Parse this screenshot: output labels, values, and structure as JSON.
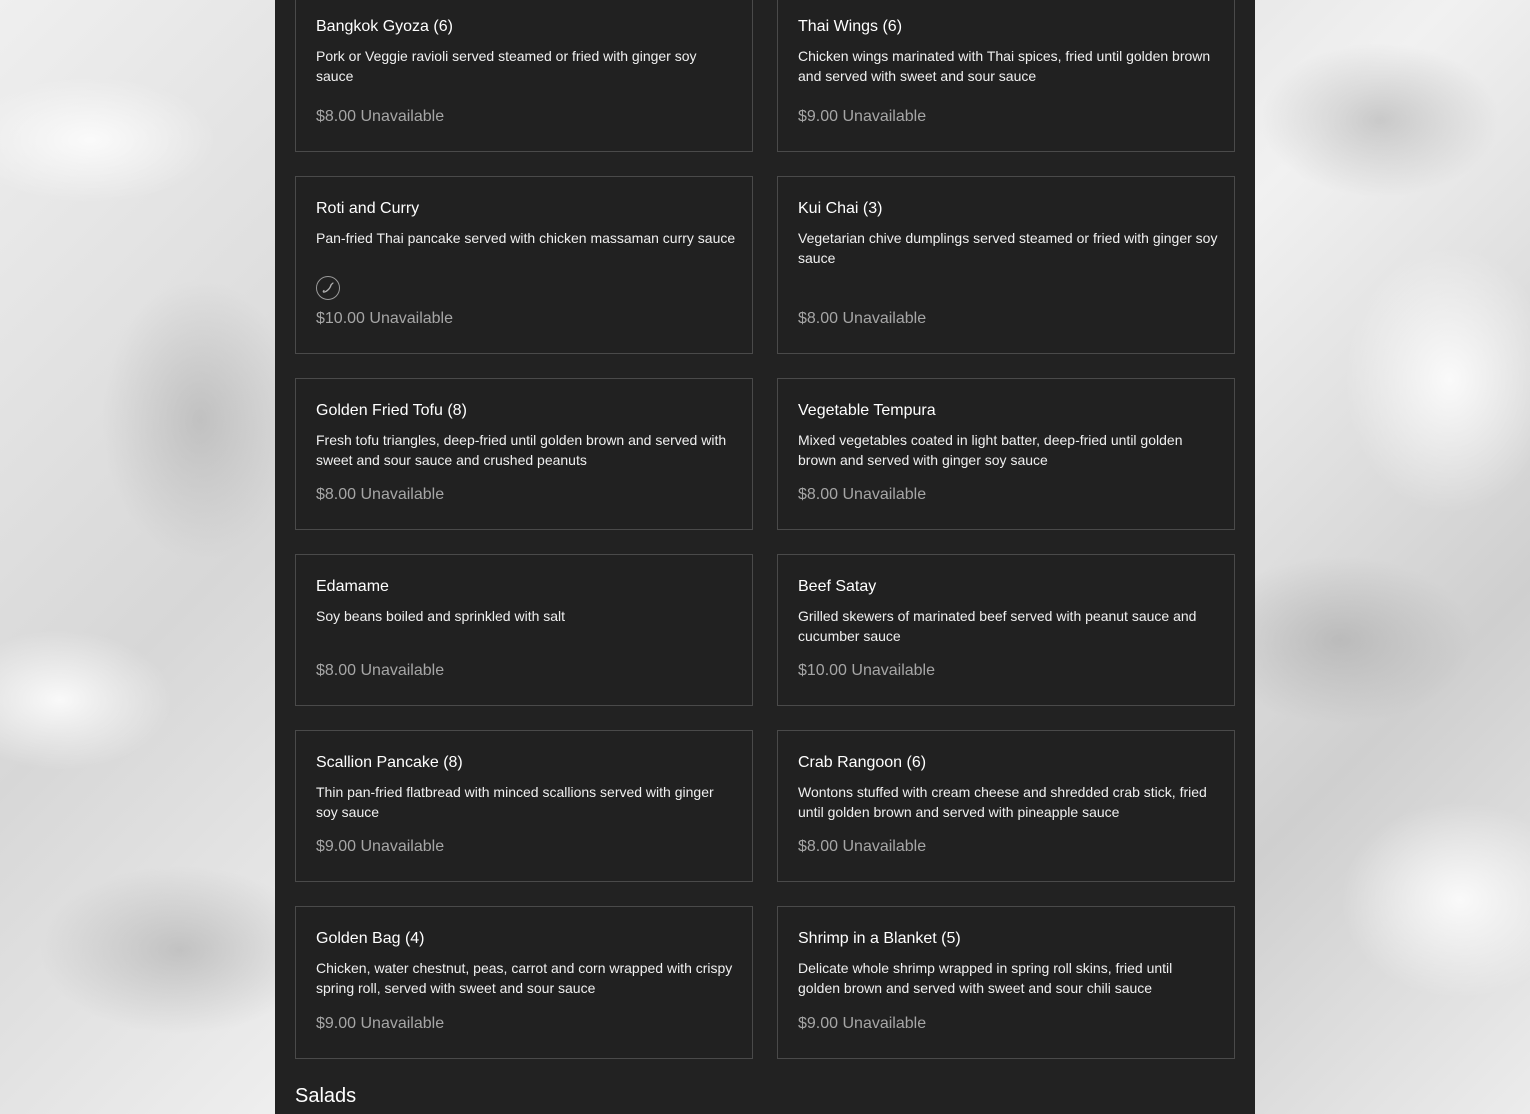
{
  "menu": {
    "items": [
      {
        "name": "Bangkok Gyoza (6)",
        "description": "Pork or Veggie ravioli served steamed or fried with ginger soy sauce",
        "price": "$8.00",
        "status": "Unavailable"
      },
      {
        "name": "Thai Wings (6)",
        "description": "Chicken wings marinated with Thai spices, fried until golden brown and served with sweet and sour sauce",
        "price": "$9.00",
        "status": "Unavailable"
      },
      {
        "name": "Roti and Curry",
        "description": "Pan-fried Thai pancake served with chicken massaman curry sauce",
        "price": "$10.00",
        "status": "Unavailable",
        "icon": "chili-pepper-icon"
      },
      {
        "name": "Kui Chai (3)",
        "description": "Vegetarian chive dumplings served steamed or fried with ginger soy sauce",
        "price": "$8.00",
        "status": "Unavailable"
      },
      {
        "name": "Golden Fried Tofu (8)",
        "description": "Fresh tofu triangles, deep-fried until golden brown and served with sweet and sour sauce and crushed peanuts",
        "price": "$8.00",
        "status": "Unavailable"
      },
      {
        "name": "Vegetable Tempura",
        "description": "Mixed vegetables coated in light batter, deep-fried until golden brown and served with ginger soy sauce",
        "price": "$8.00",
        "status": "Unavailable"
      },
      {
        "name": "Edamame",
        "description": "Soy beans boiled and sprinkled with salt",
        "price": "$8.00",
        "status": "Unavailable"
      },
      {
        "name": "Beef Satay",
        "description": "Grilled skewers of marinated beef served with peanut sauce and cucumber sauce",
        "price": "$10.00",
        "status": "Unavailable"
      },
      {
        "name": "Scallion Pancake (8)",
        "description": "Thin pan-fried flatbread with minced scallions served with ginger soy sauce",
        "price": "$9.00",
        "status": "Unavailable"
      },
      {
        "name": "Crab Rangoon (6)",
        "description": "Wontons stuffed with cream cheese and shredded crab stick, fried until golden brown and served with pineapple sauce",
        "price": "$8.00",
        "status": "Unavailable"
      },
      {
        "name": "Golden Bag (4)",
        "description": "Chicken, water chestnut, peas, carrot and corn wrapped with crispy spring roll, served with sweet and sour sauce",
        "price": "$9.00",
        "status": "Unavailable"
      },
      {
        "name": "Shrimp in a Blanket (5)",
        "description": "Delicate whole shrimp wrapped in spring roll skins, fried until golden brown and served with sweet and sour chili sauce",
        "price": "$9.00",
        "status": "Unavailable"
      }
    ],
    "next_section": "Salads"
  },
  "colors": {
    "panel_bg": "#222222",
    "card_border": "#4a4a4a",
    "price_text": "#a6a6a6",
    "title_text": "#ffffff"
  }
}
